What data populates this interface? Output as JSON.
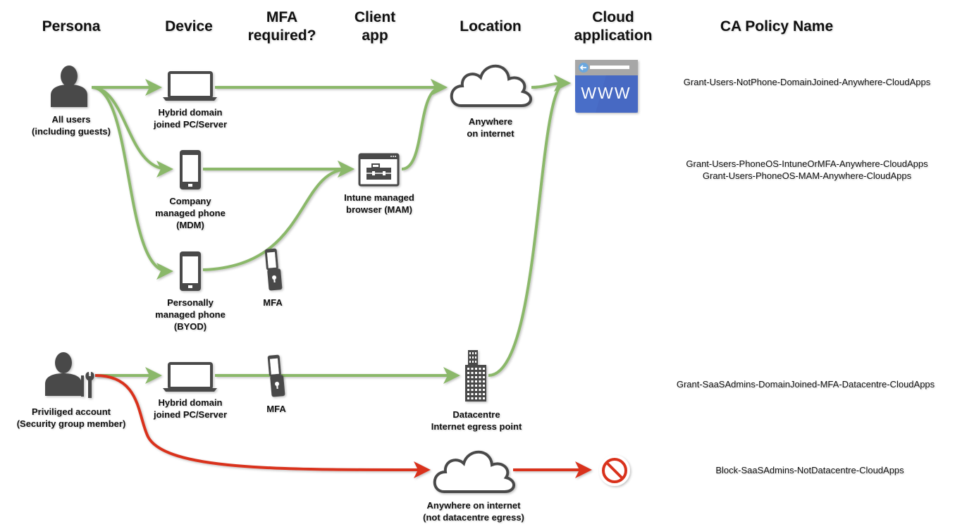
{
  "headers": {
    "persona": "Persona",
    "device": "Device",
    "mfa": [
      "MFA",
      "required?"
    ],
    "client_app": [
      "Client",
      "app"
    ],
    "location": "Location",
    "cloud_app": [
      "Cloud",
      "application"
    ],
    "policy": "CA Policy Name"
  },
  "labels": {
    "all_users": [
      "All users",
      "(including guests)"
    ],
    "hybrid_pc": [
      "Hybrid domain",
      "joined PC/Server"
    ],
    "company_phone": [
      "Company",
      "managed phone",
      "(MDM)"
    ],
    "personal_phone": [
      "Personally",
      "managed phone",
      "(BYOD)"
    ],
    "mfa": "MFA",
    "intune_browser": [
      "Intune managed",
      "browser (MAM)"
    ],
    "anywhere": [
      "Anywhere",
      "on internet"
    ],
    "priv_account": [
      "Priviliged account",
      "(Security group member)"
    ],
    "hybrid_pc2": [
      "Hybrid domain",
      "joined PC/Server"
    ],
    "mfa2": "MFA",
    "datacentre": [
      "Datacentre",
      "Internet egress point"
    ],
    "anywhere_not_dc": [
      "Anywhere on internet",
      "(not datacentre egress)"
    ],
    "www": "WWW"
  },
  "policies": [
    [
      "Grant-Users-NotPhone-DomainJoined-Anywhere-CloudApps"
    ],
    [
      "Grant-Users-PhoneOS-IntuneOrMFA-Anywhere-CloudApps",
      "Grant-Users-PhoneOS-MAM-Anywhere-CloudApps"
    ],
    [
      "Grant-SaaSAdmins-DomainJoined-MFA-Datacentre-CloudApps"
    ],
    [
      "Block-SaaSAdmins-NotDatacentre-CloudApps"
    ]
  ],
  "colors": {
    "grant_flow": "#8bb86a",
    "block_flow": "#d9311f",
    "icon": "#4a4a4a",
    "www_blue": "#4a6ec8"
  },
  "icons": [
    "user-icon",
    "laptop-icon",
    "phone-icon",
    "mfa-phone-lock-icon",
    "browser-briefcase-icon",
    "cloud-icon",
    "www-icon",
    "admin-user-wrench-icon",
    "building-icon",
    "block-icon"
  ]
}
